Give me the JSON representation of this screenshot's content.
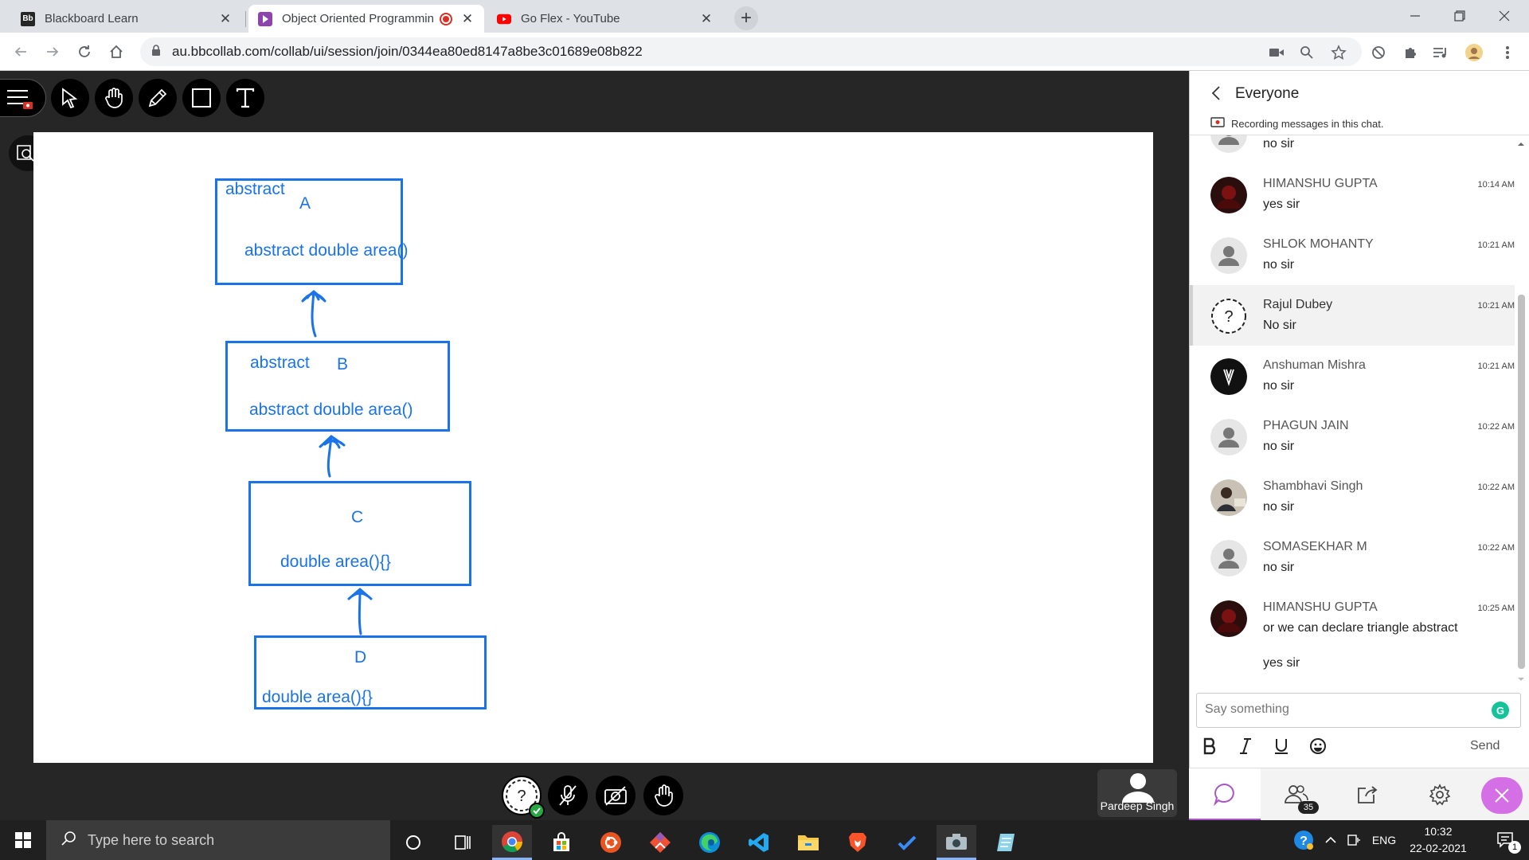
{
  "browser": {
    "tabs": [
      {
        "title": "Blackboard Learn",
        "favicon": "blackboard-icon"
      },
      {
        "title": "Object Oriented Programmin",
        "favicon": "collaborate-icon"
      },
      {
        "title": "Go Flex - YouTube",
        "favicon": "youtube-icon"
      }
    ],
    "url": "au.bbcollab.com/collab/ui/session/join/0344ea80ed8147a8be3c01689e08b822"
  },
  "whiteboard": {
    "box_a": {
      "keyword": "abstract",
      "name": "A",
      "method": "abstract double area()"
    },
    "box_b": {
      "keyword": "abstract",
      "name": "B",
      "method": "abstract double area()"
    },
    "box_c": {
      "name": "C",
      "method": "double area(){}"
    },
    "box_d": {
      "name": "D",
      "method": "double area(){}"
    }
  },
  "presenter": {
    "name": "Pardeep Singh"
  },
  "chat": {
    "title": "Everyone",
    "recording_note": "Recording messages in this chat.",
    "partial_message": "no sir",
    "messages": [
      {
        "sender": "HIMANSHU GUPTA",
        "time": "10:14 AM",
        "text": "yes sir"
      },
      {
        "sender": "SHLOK MOHANTY",
        "time": "10:21 AM",
        "text": "no sir"
      },
      {
        "sender": "Rajul Dubey",
        "time": "10:21 AM",
        "text": "No sir"
      },
      {
        "sender": "Anshuman Mishra",
        "time": "10:21 AM",
        "text": "no sir"
      },
      {
        "sender": "PHAGUN JAIN",
        "time": "10:22 AM",
        "text": "no sir"
      },
      {
        "sender": "Shambhavi Singh",
        "time": "10:22 AM",
        "text": "no sir"
      },
      {
        "sender": "SOMASEKHAR M",
        "time": "10:22 AM",
        "text": "no sir"
      },
      {
        "sender": "HIMANSHU GUPTA",
        "time": "10:25 AM",
        "text": "or we can declare triangle abstract"
      }
    ],
    "continuation": "yes sir",
    "compose_placeholder": "Say something",
    "send_label": "Send",
    "attendee_count": "35"
  },
  "taskbar": {
    "search_placeholder": "Type here to search",
    "language": "ENG",
    "time": "10:32",
    "date": "22-02-2021",
    "notification_count": "1"
  },
  "colors": {
    "accent": "#1a73e8",
    "chat_tab": "#a855c8"
  }
}
